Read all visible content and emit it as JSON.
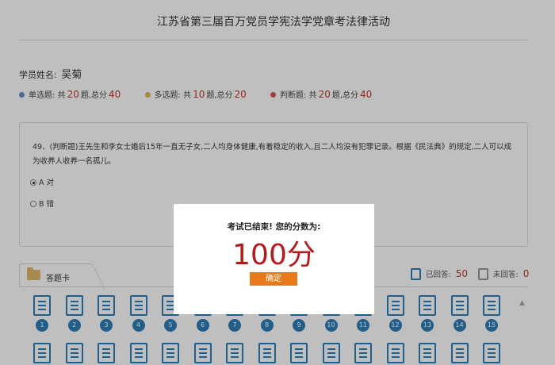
{
  "header": {
    "title": "江苏省第三届百万党员学宪法学党章考法律活动"
  },
  "student": {
    "label": "学员姓名:",
    "name": "吴菊"
  },
  "stats": [
    {
      "label_pre": "单选题: 共",
      "count": "20",
      "mid": "题,总分",
      "score": "40",
      "color": "#5b8ec8"
    },
    {
      "label_pre": "多选题: 共",
      "count": "10",
      "mid": "题,总分",
      "score": "20",
      "color": "#e0b45a"
    },
    {
      "label_pre": "判断题: 共",
      "count": "20",
      "mid": "题,总分",
      "score": "40",
      "color": "#d9534f"
    }
  ],
  "question": {
    "text": "49、(判断题)王先生和李女士婚后15年一直无子女,二人均身体健康,有着稳定的收入,且二人均没有犯罪记录。根据《民法典》的规定,二人可以成为收养人收养一名孤儿。",
    "options": [
      {
        "label": "A 对",
        "checked": true
      },
      {
        "label": "B 错",
        "checked": false
      }
    ]
  },
  "answer_card": {
    "tab_label": "答题卡",
    "answered_label": "已回答:",
    "answered_count": "50",
    "unanswered_label": "未回答:",
    "unanswered_count": "0",
    "items": [
      "1",
      "2",
      "3",
      "4",
      "5",
      "6",
      "7",
      "8",
      "9",
      "10",
      "11",
      "12",
      "13",
      "14",
      "15",
      "",
      "",
      "",
      "",
      "",
      "",
      "",
      "",
      "",
      "",
      "",
      "",
      "",
      "",
      ""
    ]
  },
  "modal": {
    "message": "考试已结束! 您的分数为:",
    "score": "100分",
    "confirm_label": "确定"
  },
  "colors": {
    "accent": "#2c7fb8",
    "score": "#b31b1b",
    "button": "#e8791b"
  },
  "icons": {
    "folder": "folder-icon",
    "doc": "document-icon",
    "scroll_up": "chevron-up-icon"
  }
}
